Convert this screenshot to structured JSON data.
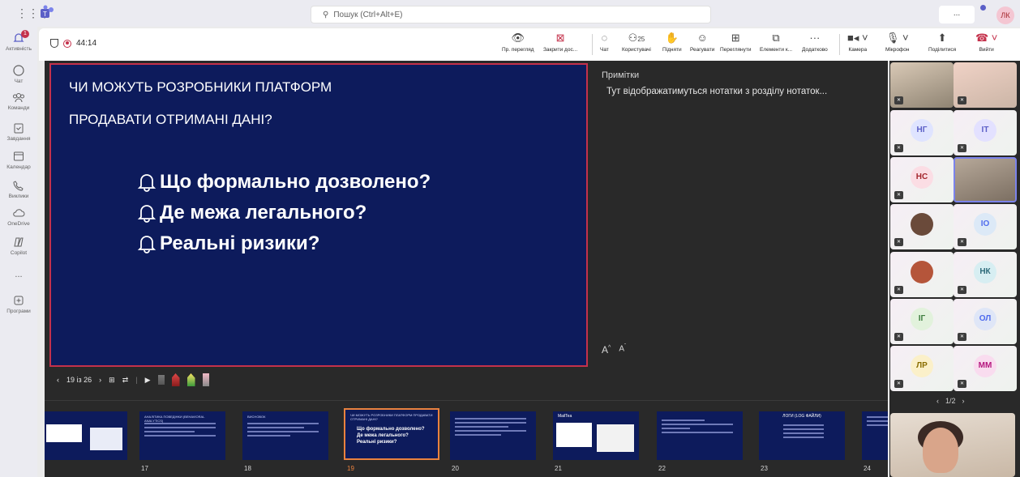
{
  "topbar": {
    "search_placeholder": "Пошук (Ctrl+Alt+E)",
    "more_label": "...",
    "user_initials": "ЛК"
  },
  "rail": {
    "items": [
      {
        "label": "Активність",
        "icon": "bell-icon",
        "badge": "1"
      },
      {
        "label": "Чат",
        "icon": "chat-icon"
      },
      {
        "label": "Команди",
        "icon": "teams-icon"
      },
      {
        "label": "Завдання",
        "icon": "tasks-icon"
      },
      {
        "label": "Календар",
        "icon": "calendar-icon"
      },
      {
        "label": "Виклики",
        "icon": "phone-icon"
      },
      {
        "label": "OneDrive",
        "icon": "onedrive-icon"
      },
      {
        "label": "Copilot",
        "icon": "copilot-icon"
      },
      {
        "label": "...",
        "icon": "more-icon"
      },
      {
        "label": "Програми",
        "icon": "apps-icon"
      }
    ]
  },
  "meeting": {
    "elapsed": "44:14"
  },
  "toolbar": {
    "view_label": "Пр. перегляд",
    "close_label": "Закрити дос...",
    "chat_label": "Чат",
    "people_label": "Користувачі",
    "people_count": "25",
    "raise_label": "Підняти",
    "react_label": "Реагувати",
    "view2_label": "Переглянути",
    "elements_label": "Елементи к...",
    "more_label": "Додатково",
    "camera_label": "Камера",
    "mic_label": "Мікрофон",
    "share_label": "Поділитися",
    "leave_label": "Вийти"
  },
  "slide": {
    "heading_line1": "ЧИ МОЖУТЬ РОЗРОБНИКИ ПЛАТФОРМ",
    "heading_line2": "ПРОДАВАТИ ОТРИМАНІ ДАНІ?",
    "bullets": [
      "Що формально дозволено?",
      "Де межа легального?",
      "Реальні ризики?"
    ]
  },
  "notes": {
    "title": "Примітки",
    "text": "Тут відображатимуться нотатки з розділу нотаток...",
    "increase_font": "A",
    "decrease_font": "A"
  },
  "slide_controls": {
    "position": "19 із 26"
  },
  "thumbnails": [
    {
      "num": "",
      "title": ""
    },
    {
      "num": "17",
      "title": "АНАЛІТИКА ПОВЕДІНКИ (BEHAVIORAL ANALYTICS)"
    },
    {
      "num": "18",
      "title": "ВИСНОВОК"
    },
    {
      "num": "19",
      "title": "ЧИ МОЖУТЬ РОЗРОБНИКИ ПЛАТФОРМ ПРОДАВАТИ ОТРИМАНІ ДАНІ?"
    },
    {
      "num": "20",
      "title": ""
    },
    {
      "num": "21",
      "title": "MailTea"
    },
    {
      "num": "22",
      "title": ""
    },
    {
      "num": "23",
      "title": "ЛОГИ (LOG ФАЙЛИ)"
    },
    {
      "num": "24",
      "title": ""
    }
  ],
  "thumb19_bullets": [
    "Що формально дозволено?",
    "Де межа легального?",
    "Реальні ризики?"
  ],
  "participants": [
    {
      "initials": "НГ",
      "color": "#5b5fc7",
      "bg": "#dfe4ff"
    },
    {
      "initials": "ІТ",
      "color": "#5b5fc7",
      "bg": "#e3e1ff"
    },
    {
      "initials": "НС",
      "color": "#a4262c",
      "bg": "#fbdde4"
    },
    {
      "initials": "ІО",
      "color": "#4f6bed",
      "bg": "#dce9f7"
    },
    {
      "initials": "НК",
      "color": "#2e6b7a",
      "bg": "#d7eef2"
    },
    {
      "initials": "ІГ",
      "color": "#3e7e3e",
      "bg": "#e2f2dc"
    },
    {
      "initials": "ОЛ",
      "color": "#4f6bed",
      "bg": "#dfe6f7"
    },
    {
      "initials": "ЛР",
      "color": "#8a6d00",
      "bg": "#fbf0c9"
    },
    {
      "initials": "ММ",
      "color": "#b5177e",
      "bg": "#f9dcef"
    }
  ],
  "gallery_pager": {
    "label": "1/2"
  },
  "colors": {
    "slide_bg": "#0d1b5c",
    "accent": "#5b5fc7",
    "recording": "#c4314b",
    "selected_thumb": "#e9823f"
  }
}
